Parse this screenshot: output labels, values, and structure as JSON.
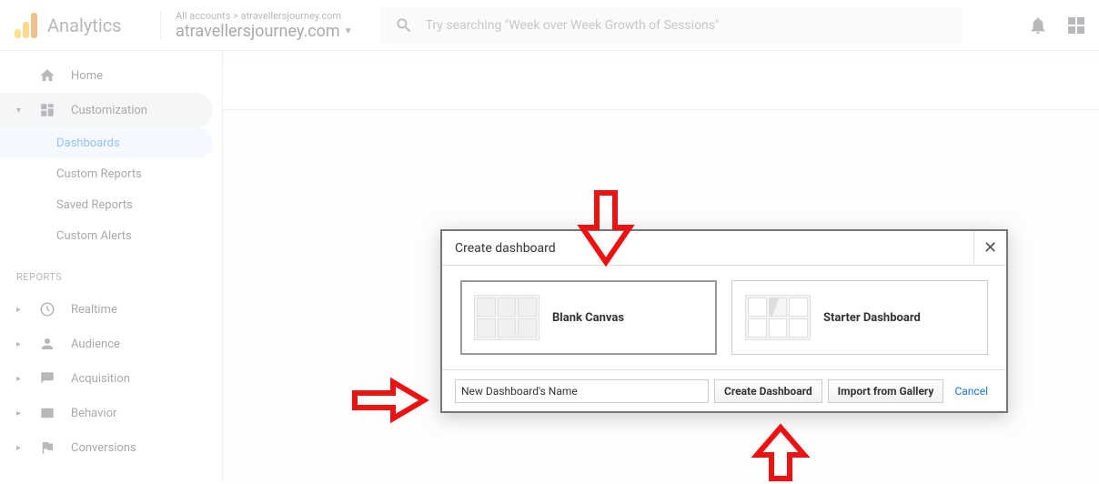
{
  "header": {
    "logo_text": "Analytics",
    "account_parent": "All accounts > atravellersjourney.com",
    "account_name": "atravellersjourney.com",
    "search_placeholder": "Try searching \"Week over Week Growth of Sessions\""
  },
  "sidebar": {
    "home": "Home",
    "customization": {
      "label": "Customization",
      "items": [
        "Dashboards",
        "Custom Reports",
        "Saved Reports",
        "Custom Alerts"
      ]
    },
    "reports_title": "REPORTS",
    "reports": [
      {
        "label": "Realtime"
      },
      {
        "label": "Audience"
      },
      {
        "label": "Acquisition"
      },
      {
        "label": "Behavior"
      },
      {
        "label": "Conversions"
      }
    ]
  },
  "dialog": {
    "title": "Create dashboard",
    "templates": {
      "blank": "Blank Canvas",
      "starter": "Starter Dashboard"
    },
    "name_value": "New Dashboard's Name",
    "create_btn": "Create Dashboard",
    "import_btn": "Import from Gallery",
    "cancel": "Cancel"
  }
}
